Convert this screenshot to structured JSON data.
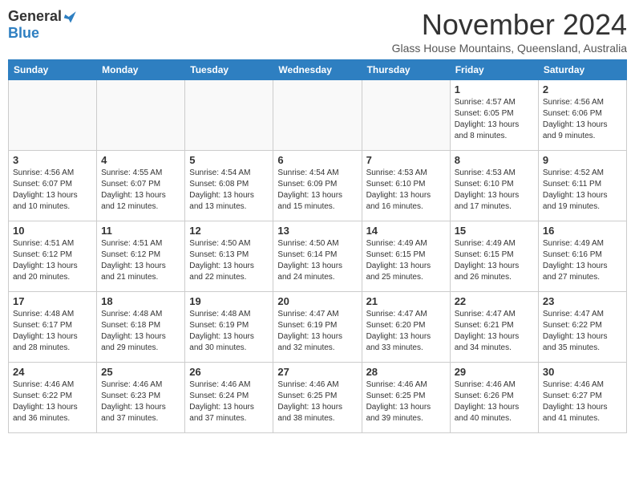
{
  "logo": {
    "general": "General",
    "blue": "Blue"
  },
  "title": "November 2024",
  "location": "Glass House Mountains, Queensland, Australia",
  "days_of_week": [
    "Sunday",
    "Monday",
    "Tuesday",
    "Wednesday",
    "Thursday",
    "Friday",
    "Saturday"
  ],
  "weeks": [
    [
      {
        "day": "",
        "info": ""
      },
      {
        "day": "",
        "info": ""
      },
      {
        "day": "",
        "info": ""
      },
      {
        "day": "",
        "info": ""
      },
      {
        "day": "",
        "info": ""
      },
      {
        "day": "1",
        "info": "Sunrise: 4:57 AM\nSunset: 6:05 PM\nDaylight: 13 hours and 8 minutes."
      },
      {
        "day": "2",
        "info": "Sunrise: 4:56 AM\nSunset: 6:06 PM\nDaylight: 13 hours and 9 minutes."
      }
    ],
    [
      {
        "day": "3",
        "info": "Sunrise: 4:56 AM\nSunset: 6:07 PM\nDaylight: 13 hours and 10 minutes."
      },
      {
        "day": "4",
        "info": "Sunrise: 4:55 AM\nSunset: 6:07 PM\nDaylight: 13 hours and 12 minutes."
      },
      {
        "day": "5",
        "info": "Sunrise: 4:54 AM\nSunset: 6:08 PM\nDaylight: 13 hours and 13 minutes."
      },
      {
        "day": "6",
        "info": "Sunrise: 4:54 AM\nSunset: 6:09 PM\nDaylight: 13 hours and 15 minutes."
      },
      {
        "day": "7",
        "info": "Sunrise: 4:53 AM\nSunset: 6:10 PM\nDaylight: 13 hours and 16 minutes."
      },
      {
        "day": "8",
        "info": "Sunrise: 4:53 AM\nSunset: 6:10 PM\nDaylight: 13 hours and 17 minutes."
      },
      {
        "day": "9",
        "info": "Sunrise: 4:52 AM\nSunset: 6:11 PM\nDaylight: 13 hours and 19 minutes."
      }
    ],
    [
      {
        "day": "10",
        "info": "Sunrise: 4:51 AM\nSunset: 6:12 PM\nDaylight: 13 hours and 20 minutes."
      },
      {
        "day": "11",
        "info": "Sunrise: 4:51 AM\nSunset: 6:12 PM\nDaylight: 13 hours and 21 minutes."
      },
      {
        "day": "12",
        "info": "Sunrise: 4:50 AM\nSunset: 6:13 PM\nDaylight: 13 hours and 22 minutes."
      },
      {
        "day": "13",
        "info": "Sunrise: 4:50 AM\nSunset: 6:14 PM\nDaylight: 13 hours and 24 minutes."
      },
      {
        "day": "14",
        "info": "Sunrise: 4:49 AM\nSunset: 6:15 PM\nDaylight: 13 hours and 25 minutes."
      },
      {
        "day": "15",
        "info": "Sunrise: 4:49 AM\nSunset: 6:15 PM\nDaylight: 13 hours and 26 minutes."
      },
      {
        "day": "16",
        "info": "Sunrise: 4:49 AM\nSunset: 6:16 PM\nDaylight: 13 hours and 27 minutes."
      }
    ],
    [
      {
        "day": "17",
        "info": "Sunrise: 4:48 AM\nSunset: 6:17 PM\nDaylight: 13 hours and 28 minutes."
      },
      {
        "day": "18",
        "info": "Sunrise: 4:48 AM\nSunset: 6:18 PM\nDaylight: 13 hours and 29 minutes."
      },
      {
        "day": "19",
        "info": "Sunrise: 4:48 AM\nSunset: 6:19 PM\nDaylight: 13 hours and 30 minutes."
      },
      {
        "day": "20",
        "info": "Sunrise: 4:47 AM\nSunset: 6:19 PM\nDaylight: 13 hours and 32 minutes."
      },
      {
        "day": "21",
        "info": "Sunrise: 4:47 AM\nSunset: 6:20 PM\nDaylight: 13 hours and 33 minutes."
      },
      {
        "day": "22",
        "info": "Sunrise: 4:47 AM\nSunset: 6:21 PM\nDaylight: 13 hours and 34 minutes."
      },
      {
        "day": "23",
        "info": "Sunrise: 4:47 AM\nSunset: 6:22 PM\nDaylight: 13 hours and 35 minutes."
      }
    ],
    [
      {
        "day": "24",
        "info": "Sunrise: 4:46 AM\nSunset: 6:22 PM\nDaylight: 13 hours and 36 minutes."
      },
      {
        "day": "25",
        "info": "Sunrise: 4:46 AM\nSunset: 6:23 PM\nDaylight: 13 hours and 37 minutes."
      },
      {
        "day": "26",
        "info": "Sunrise: 4:46 AM\nSunset: 6:24 PM\nDaylight: 13 hours and 37 minutes."
      },
      {
        "day": "27",
        "info": "Sunrise: 4:46 AM\nSunset: 6:25 PM\nDaylight: 13 hours and 38 minutes."
      },
      {
        "day": "28",
        "info": "Sunrise: 4:46 AM\nSunset: 6:25 PM\nDaylight: 13 hours and 39 minutes."
      },
      {
        "day": "29",
        "info": "Sunrise: 4:46 AM\nSunset: 6:26 PM\nDaylight: 13 hours and 40 minutes."
      },
      {
        "day": "30",
        "info": "Sunrise: 4:46 AM\nSunset: 6:27 PM\nDaylight: 13 hours and 41 minutes."
      }
    ]
  ]
}
